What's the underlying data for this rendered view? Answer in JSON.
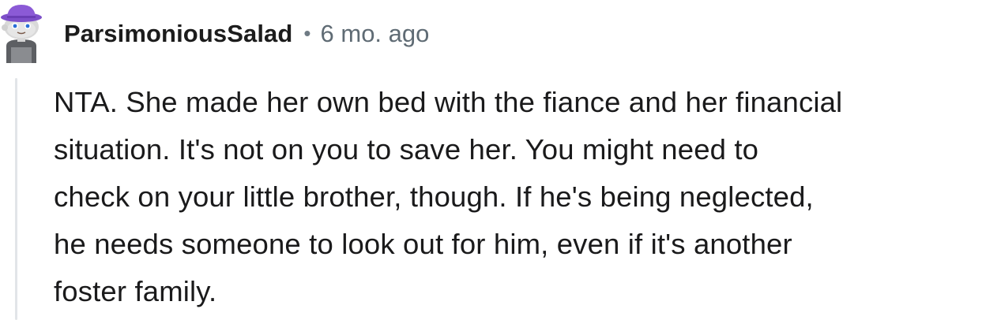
{
  "comment": {
    "username": "ParsimoniousSalad",
    "separator": "•",
    "timestamp": "6 mo. ago",
    "avatar_icon": "snoo-avatar-icon",
    "body_lines": [
      "NTA. She made her own bed with the fiance and her financial",
      "situation. It's not on you to save her. You might need to",
      "check on your little brother, though. If he's being neglected,",
      "he needs someone to look out for him, even if it's another",
      "foster family."
    ]
  },
  "colors": {
    "username": "#1c1c1c",
    "meta": "#5f6b74",
    "body": "#1a1a1b",
    "thread_line": "#e2e5e8",
    "avatar_hat": "#8b5ad6",
    "avatar_face": "#d9d9d9"
  }
}
